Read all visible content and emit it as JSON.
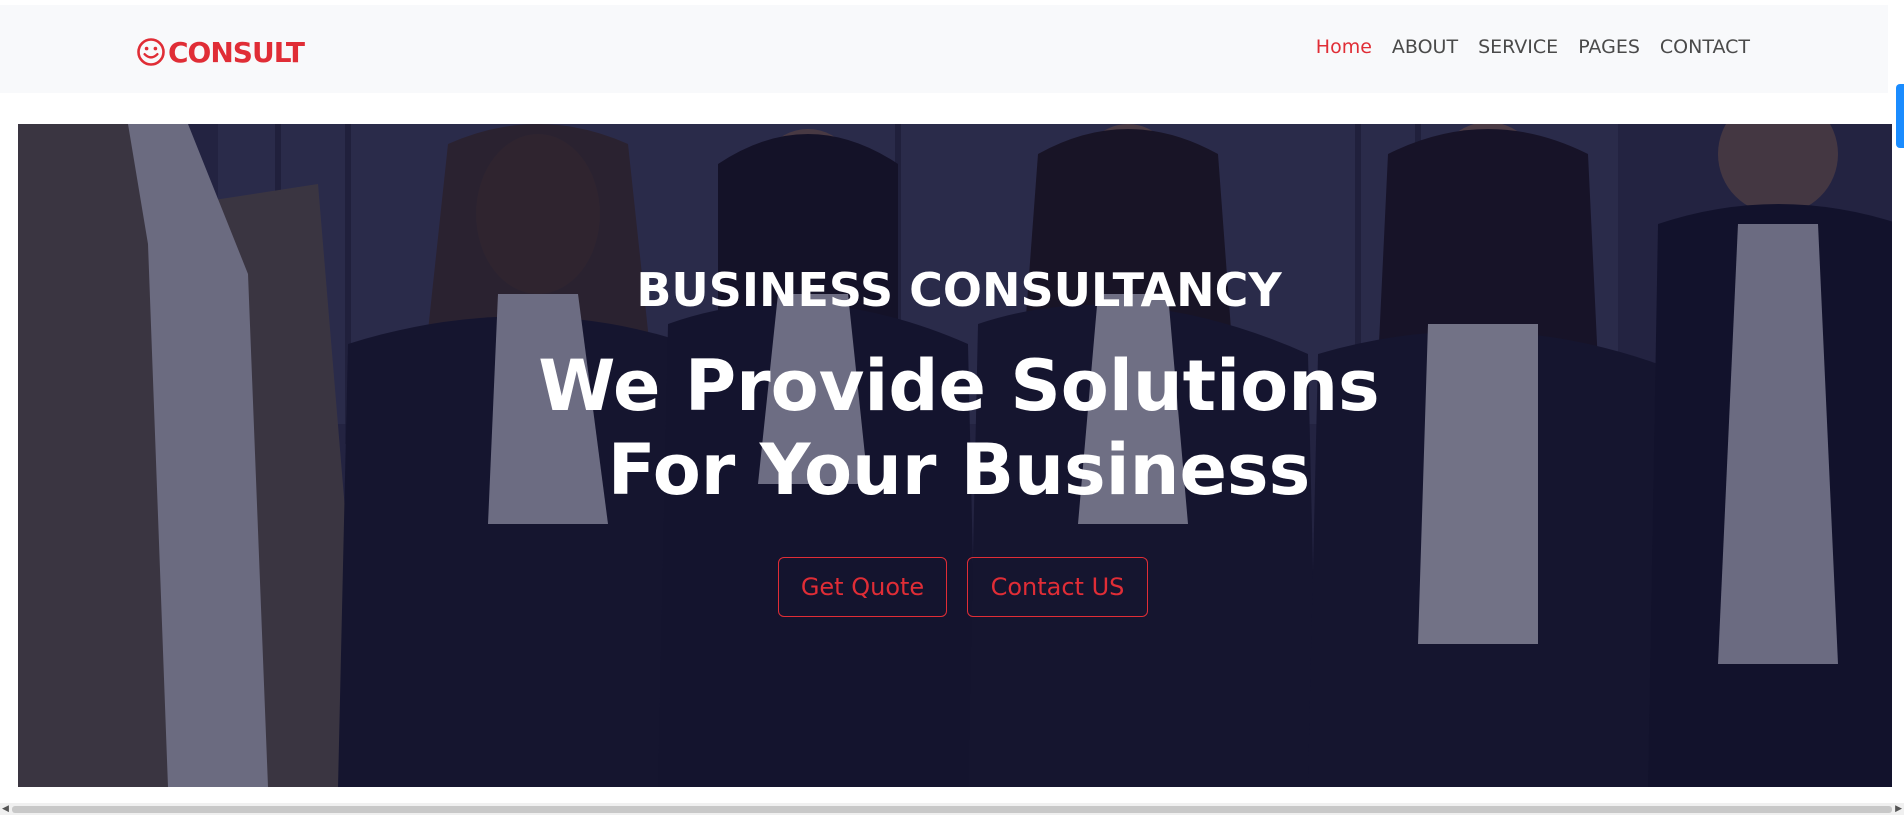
{
  "brand": {
    "icon": "smiley-face-icon",
    "text": "CONSULT",
    "color": "#e02d36"
  },
  "nav": {
    "items": [
      {
        "label": "Home",
        "active": true
      },
      {
        "label": "ABOUT",
        "active": false
      },
      {
        "label": "SERVICE",
        "active": false
      },
      {
        "label": "PAGES",
        "active": false
      },
      {
        "label": "CONTACT",
        "active": false
      }
    ]
  },
  "hero": {
    "kicker": "BUSINESS CONSULTANCY",
    "title_line1": "We Provide Solutions",
    "title_line2": "For Your Business",
    "buttons": {
      "quote": "Get Quote",
      "contact": "Contact US"
    },
    "background_image": "team-of-business-people-photo"
  },
  "colors": {
    "accent": "#e02d36",
    "nav_text": "#4a4a4a",
    "navbar_bg": "#f8f9fb",
    "scroll_thumb": "#1a8cff"
  }
}
